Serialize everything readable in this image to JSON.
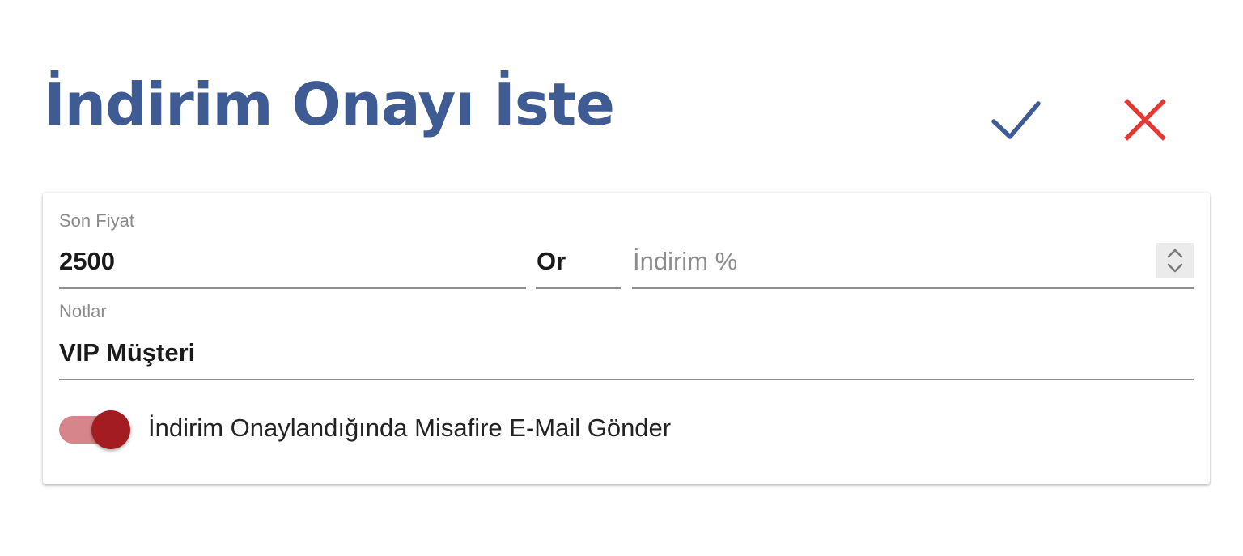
{
  "dialog": {
    "title": "İndirim Onayı İste",
    "confirm_icon": "check-icon",
    "cancel_icon": "close-icon",
    "accent_color": "#3f5b94",
    "cancel_color": "#e53935"
  },
  "form": {
    "final_price": {
      "label": "Son Fiyat",
      "value": "2500"
    },
    "separator": "Or",
    "discount_percent": {
      "placeholder": "İndirim %",
      "value": ""
    },
    "notes": {
      "label": "Notlar",
      "value": "VIP Müşteri"
    },
    "email_toggle": {
      "label": "İndirim Onaylandığında Misafire E-Mail Gönder",
      "checked": true,
      "track_color": "#d6868a",
      "knob_color": "#a31c22"
    }
  }
}
